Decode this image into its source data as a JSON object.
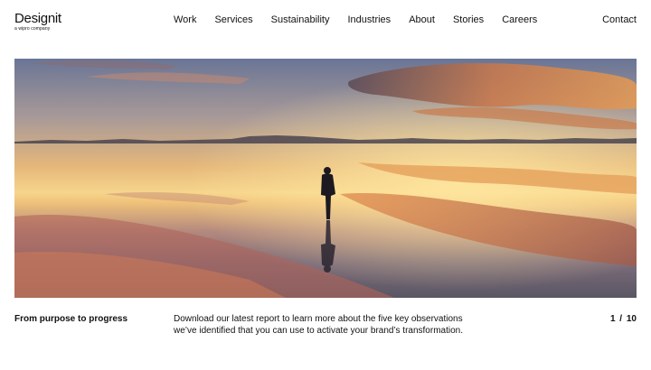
{
  "brand": {
    "name": "Designit",
    "tagline": "a wipro company"
  },
  "nav": {
    "items": [
      {
        "label": "Work"
      },
      {
        "label": "Services"
      },
      {
        "label": "Sustainability"
      },
      {
        "label": "Industries"
      },
      {
        "label": "About"
      },
      {
        "label": "Stories"
      },
      {
        "label": "Careers"
      }
    ],
    "contact": "Contact"
  },
  "hero": {
    "image": "person-standing-on-reflective-salt-flat-at-sunset",
    "colors": {
      "sky_top": "#5d6a8a",
      "horizon": "#f3c46a",
      "cloud": "#e89a55",
      "shadow": "#2a2a30"
    }
  },
  "slide": {
    "title": "From purpose to progress",
    "description": "Download our latest report to learn more about the five key observations we’ve identified that you can use to activate your brand’s transformation.",
    "counter": "1 / 10"
  }
}
